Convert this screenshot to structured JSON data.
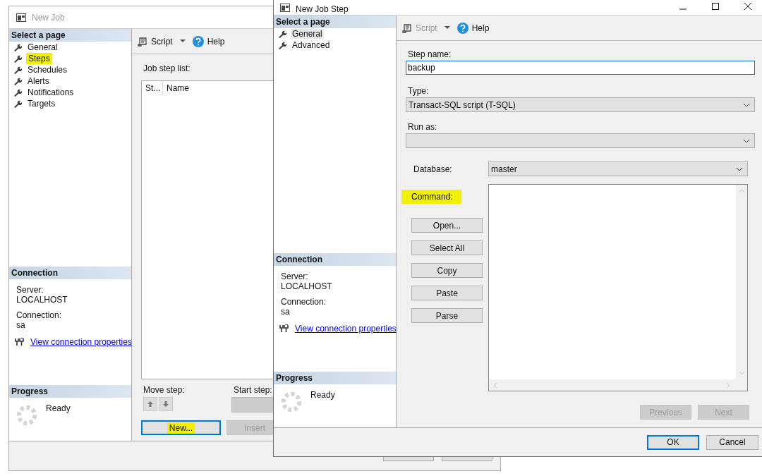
{
  "back_window": {
    "title": "New Job",
    "active": false,
    "select_page": {
      "heading": "Select a page",
      "items": [
        {
          "label": "General",
          "selected": false,
          "highlighted": false
        },
        {
          "label": "Steps",
          "selected": false,
          "highlighted": true
        },
        {
          "label": "Schedules",
          "selected": false,
          "highlighted": false
        },
        {
          "label": "Alerts",
          "selected": false,
          "highlighted": false
        },
        {
          "label": "Notifications",
          "selected": false,
          "highlighted": false
        },
        {
          "label": "Targets",
          "selected": false,
          "highlighted": false
        }
      ]
    },
    "connection": {
      "heading": "Connection",
      "server_label": "Server:",
      "server": "LOCALHOST",
      "connection_label": "Connection:",
      "connection": "sa",
      "link": "View connection properties"
    },
    "progress": {
      "heading": "Progress",
      "status": "Ready"
    },
    "toolbar": {
      "script": "Script",
      "script_disabled": false,
      "help": "Help"
    },
    "job_step_list": {
      "label": "Job step list:",
      "columns": [
        "St...",
        "Name"
      ]
    },
    "move_step": "Move step:",
    "start_step": "Start step:",
    "buttons": [
      {
        "label": "New...",
        "focused": true,
        "highlighted": true,
        "disabled": false
      },
      {
        "label": "Insert",
        "focused": false,
        "highlighted": false,
        "disabled": true
      }
    ]
  },
  "front_window": {
    "title": "New Job Step",
    "active": true,
    "select_page": {
      "heading": "Select a page",
      "items": [
        {
          "label": "General",
          "selected": true,
          "highlighted": false
        },
        {
          "label": "Advanced",
          "selected": false,
          "highlighted": false
        }
      ]
    },
    "connection": {
      "heading": "Connection",
      "server_label": "Server:",
      "server": "LOCALHOST",
      "connection_label": "Connection:",
      "connection": "sa",
      "link": "View connection properties"
    },
    "progress": {
      "heading": "Progress",
      "status": "Ready"
    },
    "toolbar": {
      "script": "Script",
      "script_disabled": true,
      "help": "Help"
    },
    "step_name": {
      "label": "Step name:",
      "value": "backup"
    },
    "type": {
      "label": "Type:",
      "value": "Transact-SQL script (T-SQL)"
    },
    "run_as": {
      "label": "Run as:"
    },
    "database": {
      "label": "Database:",
      "value": "master"
    },
    "command": {
      "label": "Command:",
      "highlighted": true
    },
    "command_buttons": [
      "Open...",
      "Select All",
      "Copy",
      "Paste",
      "Parse"
    ],
    "nav_buttons": [
      {
        "label": "Previous",
        "disabled": true
      },
      {
        "label": "Next",
        "disabled": true
      }
    ],
    "dialog_buttons": [
      {
        "label": "OK",
        "focused": true
      },
      {
        "label": "Cancel",
        "focused": false
      }
    ]
  }
}
